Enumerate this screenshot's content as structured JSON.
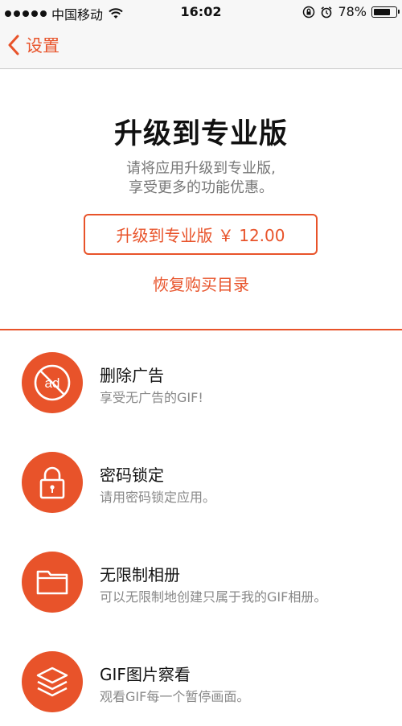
{
  "status_bar": {
    "carrier": "中国移动",
    "time": "16:02",
    "battery": "78%",
    "battery_level": 0.78
  },
  "nav": {
    "back_label": "设置"
  },
  "hero": {
    "title": "升级到专业版",
    "subtitle_line1": "请将应用升级到专业版,",
    "subtitle_line2": "享受更多的功能优惠。",
    "upgrade_button": "升级到专业版 ￥ 12.00",
    "restore_link": "恢复购买目录"
  },
  "features": [
    {
      "icon": "no-ads-icon",
      "title": "删除广告",
      "desc": "享受无广告的GIF!"
    },
    {
      "icon": "lock-icon",
      "title": "密码锁定",
      "desc": "请用密码锁定应用。"
    },
    {
      "icon": "folder-icon",
      "title": "无限制相册",
      "desc": "可以无限制地创建只属于我的GIF相册。"
    },
    {
      "icon": "layers-icon",
      "title": "GIF图片察看",
      "desc": "观看GIF每一个暂停画面。"
    }
  ],
  "colors": {
    "accent": "#e8532a",
    "text": "#111111",
    "muted": "#888888"
  }
}
